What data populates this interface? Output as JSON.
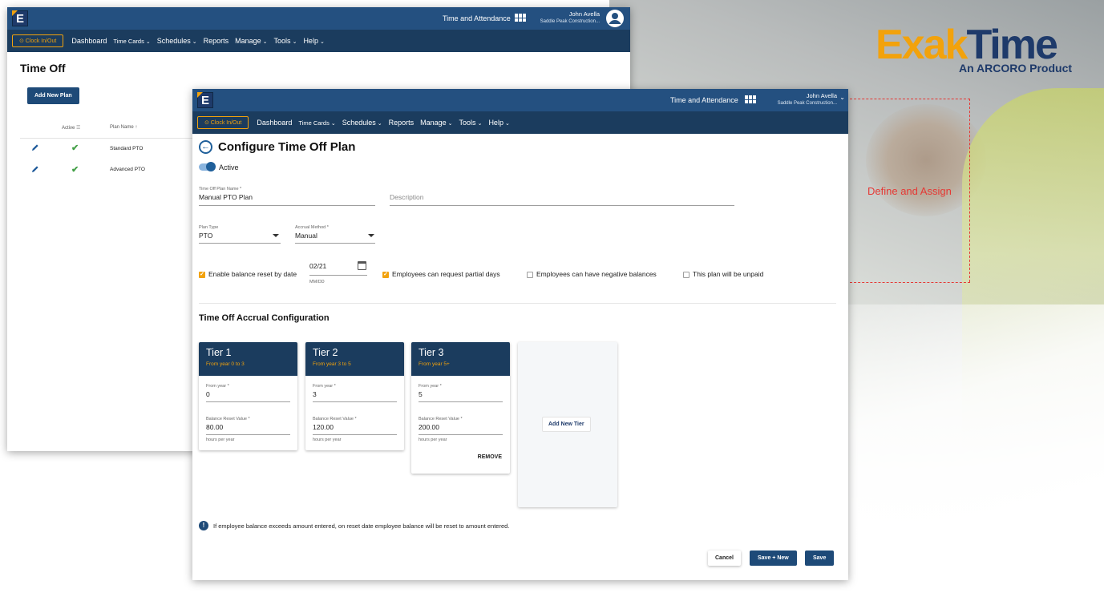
{
  "brand": {
    "name_orange": "Exak",
    "name_navy": "Time",
    "tagline": "An ARCORO Product",
    "callout": "Define and Assign",
    "colors": {
      "orange": "#f2a20c",
      "navy": "#1e3a6a",
      "callout": "#e53935"
    }
  },
  "back_window": {
    "header": {
      "logo": "E",
      "app_label": "Time and Attendance",
      "user_name": "John Avella",
      "company": "Saddle Peak Construction..."
    },
    "nav": {
      "clock_button": "⊙ Clock In/Out",
      "items": [
        "Dashboard",
        "Time Cards",
        "Schedules",
        "Reports",
        "Manage",
        "Tools",
        "Help"
      ]
    },
    "title": "Time Off",
    "add_button": "Add New Plan",
    "table": {
      "col_active": "Active",
      "col_plan_name": "Plan Name",
      "rows": [
        {
          "name": "Standard PTO"
        },
        {
          "name": "Advanced PTO"
        }
      ]
    }
  },
  "front_window": {
    "header": {
      "logo": "E",
      "app_label": "Time and Attendance",
      "user_name": "John Avella",
      "company": "Saddle Peak Construction..."
    },
    "nav": {
      "clock_button": "⊙ Clock In/Out",
      "items": [
        "Dashboard",
        "Time Cards",
        "Schedules",
        "Reports",
        "Manage",
        "Tools",
        "Help"
      ]
    },
    "title": "Configure Time Off Plan",
    "active_label": "Active",
    "plan_name_label": "Time Off Plan Name *",
    "plan_name_value": "Manual PTO Plan",
    "description_placeholder": "Description",
    "plan_type_label": "Plan Type",
    "plan_type_value": "PTO",
    "accrual_label": "Accrual Method *",
    "accrual_value": "Manual",
    "reset_checkbox": "Enable balance reset by date",
    "reset_date": "02/21",
    "reset_date_hint": "MM/DD",
    "partial_days": "Employees can request partial days",
    "negative_balances": "Employees can have negative balances",
    "unpaid": "This plan will be unpaid",
    "section_title": "Time Off Accrual Configuration",
    "tiers": [
      {
        "name": "Tier 1",
        "range": "From year 0 to 3",
        "from_label": "From year *",
        "from_value": "0",
        "reset_label": "Balance Reset Value *",
        "reset_value": "80.00",
        "hint": "hours per year"
      },
      {
        "name": "Tier 2",
        "range": "From year 3 to 5",
        "from_label": "From year *",
        "from_value": "3",
        "reset_label": "Balance Reset Value *",
        "reset_value": "120.00",
        "hint": "hours per year"
      },
      {
        "name": "Tier 3",
        "range": "From year 5+",
        "from_label": "From year *",
        "from_value": "5",
        "reset_label": "Balance Reset Value *",
        "reset_value": "200.00",
        "hint": "hours per year",
        "remove": "REMOVE"
      }
    ],
    "add_tier": "Add New Tier",
    "info_icon": "!",
    "info_text": "If employee balance exceeds amount entered, on reset date employee balance will be reset to amount entered.",
    "cancel": "Cancel",
    "save_new": "Save + New",
    "save": "Save"
  }
}
